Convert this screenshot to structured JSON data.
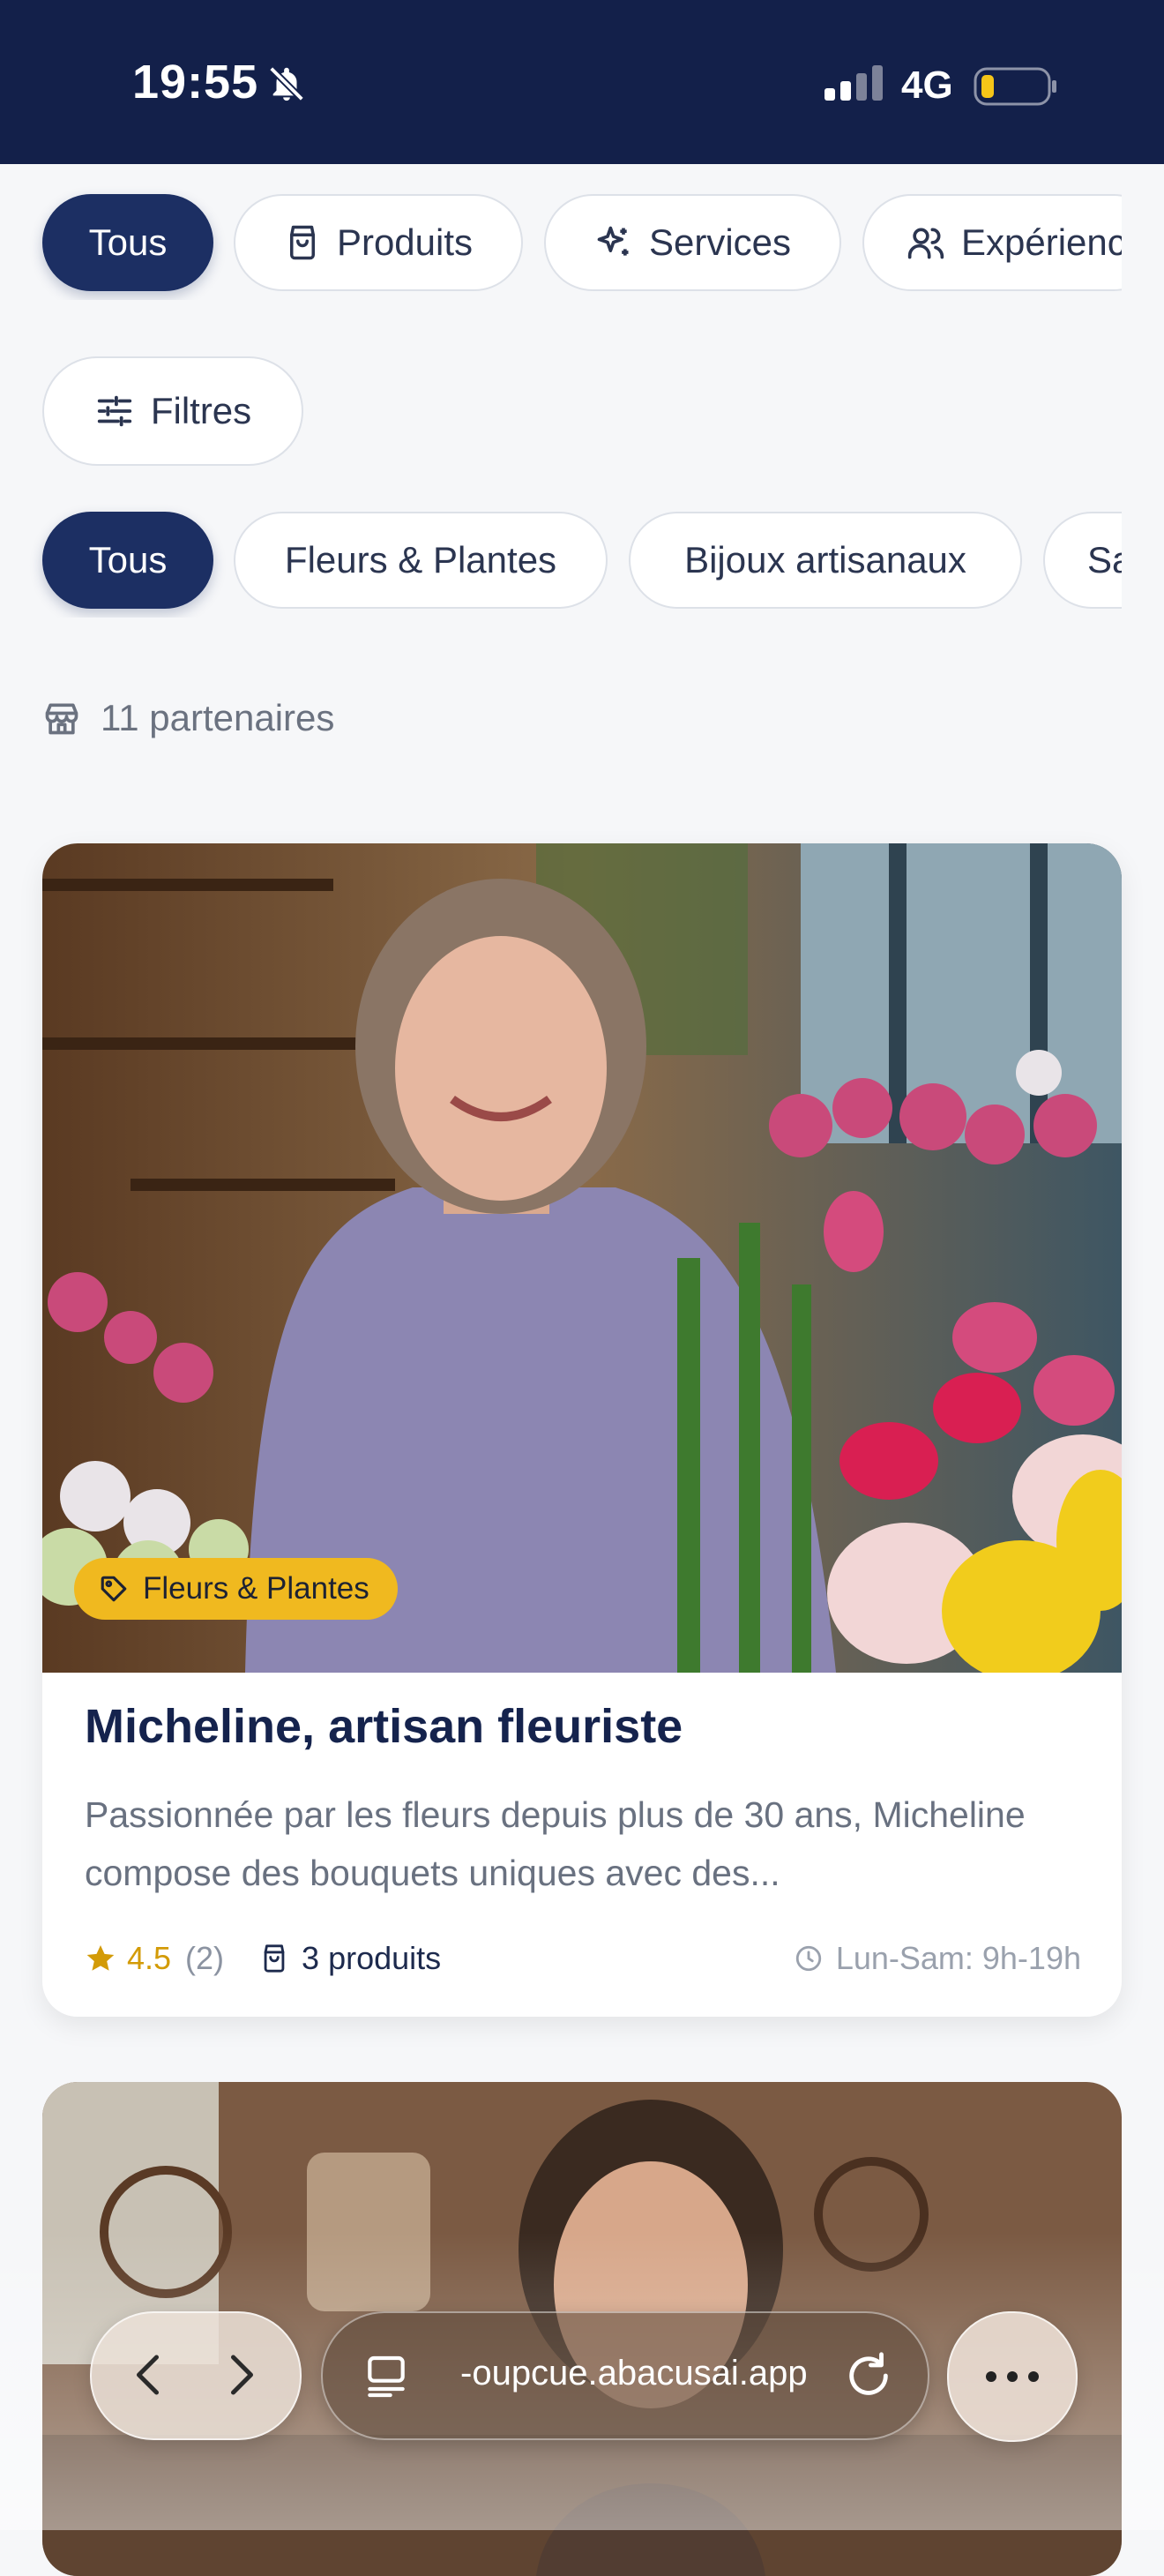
{
  "status_bar": {
    "time": "19:55",
    "network": "4G"
  },
  "type_tabs": [
    {
      "label": "Tous",
      "active": true
    },
    {
      "label": "Produits",
      "icon": "shopping-bag-icon"
    },
    {
      "label": "Services",
      "icon": "sparkles-icon"
    },
    {
      "label": "Expérienc",
      "icon": "users-icon"
    }
  ],
  "filters_button": {
    "label": "Filtres",
    "icon": "sliders-icon"
  },
  "category_tabs": [
    {
      "label": "Tous",
      "active": true
    },
    {
      "label": "Fleurs & Plantes"
    },
    {
      "label": "Bijoux artisanaux"
    },
    {
      "label": "Sa"
    }
  ],
  "partners_count": "11 partenaires",
  "cards": [
    {
      "badge": "Fleurs & Plantes",
      "title": "Micheline, artisan fleuriste",
      "description": "Passionnée par les fleurs depuis plus de 30 ans, Micheline compose des bouquets uniques avec des...",
      "rating": "4.5",
      "rating_count": "(2)",
      "products": "3 produits",
      "hours": "Lun-Sam: 9h-19h"
    }
  ],
  "browser": {
    "url": "-oupcue.abacusai.app"
  },
  "colors": {
    "primary": "#1c2f63",
    "badge": "#f0b91f",
    "star": "#d39b07",
    "status_bar": "#13204a"
  }
}
